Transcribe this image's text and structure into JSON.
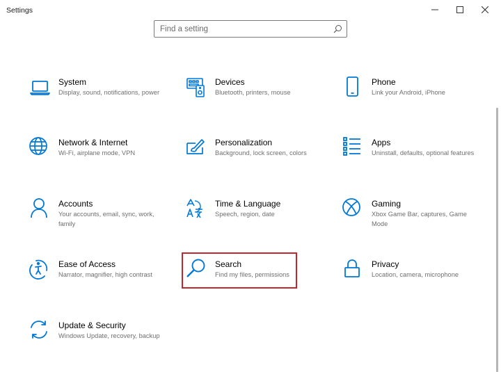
{
  "window": {
    "title": "Settings",
    "minimize_icon": "minimize-icon",
    "maximize_icon": "maximize-icon",
    "close_icon": "close-icon"
  },
  "search": {
    "placeholder": "Find a setting",
    "value": "",
    "icon": "search-icon"
  },
  "accent_color": "#0078d7",
  "highlight_color": "#c1272d",
  "categories": [
    {
      "label": "System",
      "description": "Display, sound, notifications, power",
      "icon": "laptop-icon"
    },
    {
      "label": "Devices",
      "description": "Bluetooth, printers, mouse",
      "icon": "keyboard-devices-icon"
    },
    {
      "label": "Phone",
      "description": "Link your Android, iPhone",
      "icon": "phone-icon"
    },
    {
      "label": "Network & Internet",
      "description": "Wi-Fi, airplane mode, VPN",
      "icon": "globe-icon"
    },
    {
      "label": "Personalization",
      "description": "Background, lock screen, colors",
      "icon": "paint-brush-icon"
    },
    {
      "label": "Apps",
      "description": "Uninstall, defaults, optional features",
      "icon": "apps-list-icon"
    },
    {
      "label": "Accounts",
      "description": "Your accounts, email, sync, work, family",
      "icon": "person-icon"
    },
    {
      "label": "Time & Language",
      "description": "Speech, region, date",
      "icon": "language-icon"
    },
    {
      "label": "Gaming",
      "description": "Xbox Game Bar, captures, Game Mode",
      "icon": "xbox-icon"
    },
    {
      "label": "Ease of Access",
      "description": "Narrator, magnifier, high contrast",
      "icon": "ease-of-access-icon"
    },
    {
      "label": "Search",
      "description": "Find my files, permissions",
      "icon": "search-icon",
      "highlighted": true
    },
    {
      "label": "Privacy",
      "description": "Location, camera, microphone",
      "icon": "lock-icon"
    },
    {
      "label": "Update & Security",
      "description": "Windows Update, recovery, backup",
      "icon": "sync-icon"
    }
  ]
}
